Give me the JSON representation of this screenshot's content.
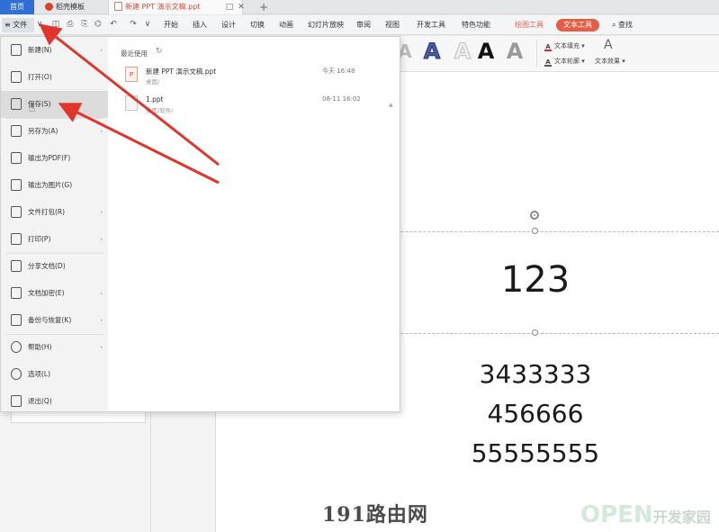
{
  "tabs": {
    "home": "首页",
    "templates": "稻壳模板",
    "document": "新建 PPT 演示文稿.ppt",
    "window_icon": "□",
    "close": "✕",
    "add": "+"
  },
  "menubar": {
    "file_label": "≡ 文件",
    "dropdown_caret": "∨",
    "items": [
      "开始",
      "插入",
      "设计",
      "切换",
      "动画",
      "幻灯片放映",
      "审阅",
      "视图",
      "开发工具",
      "特色功能"
    ],
    "drawing_tools": "绘图工具",
    "text_tools": "文本工具",
    "search": "查找",
    "quick_access": [
      "◫",
      "⎙",
      "⎘",
      "⌬",
      "↶",
      "↷",
      "∨"
    ]
  },
  "ribbon": {
    "art_samples": [
      "A",
      "A",
      "A",
      "A",
      "A"
    ],
    "text_fill": "文本填充",
    "text_outline": "文本轮廓",
    "text_effect": "文本效果",
    "effect_glyph": "A"
  },
  "file_menu": {
    "items": [
      {
        "label": "新建(N)",
        "has_submenu": true
      },
      {
        "label": "打开(O)",
        "has_submenu": false
      },
      {
        "label": "保存(S)",
        "has_submenu": false,
        "active": true
      },
      {
        "label": "另存为(A)",
        "has_submenu": true
      },
      {
        "label": "输出为PDF(F)",
        "has_submenu": false
      },
      {
        "label": "输出为图片(G)",
        "has_submenu": false
      },
      {
        "label": "文件打包(R)",
        "has_submenu": true
      },
      {
        "label": "打印(P)",
        "has_submenu": true
      },
      {
        "label": "分享文档(D)",
        "has_submenu": false
      },
      {
        "label": "文档加密(E)",
        "has_submenu": true
      },
      {
        "label": "备份与恢复(K)",
        "has_submenu": true
      },
      {
        "label": "帮助(H)",
        "has_submenu": true
      },
      {
        "label": "选项(L)",
        "has_submenu": false
      },
      {
        "label": "退出(Q)",
        "has_submenu": false
      }
    ],
    "submenu_arrow": "›",
    "recent_header": "最近使用",
    "recent_refresh": "↻",
    "recent_files": [
      {
        "name": "新建 PPT 演示文稿.ppt",
        "path": "桌面/",
        "date": "今天 16:48"
      },
      {
        "name": "1.ppt",
        "path": "桌面/软件/",
        "date": "08-11 16:02"
      }
    ],
    "file_icon_glyph": "P",
    "pin_glyph": "▲"
  },
  "slide": {
    "title_text": "123",
    "body_lines": [
      "3433333",
      "456666",
      "55555555"
    ]
  },
  "watermarks": {
    "site": "191路由网",
    "open_big": "OPEN",
    "open_small": "开发家园"
  },
  "colors": {
    "accent_blue": "#2f6fd6",
    "accent_red": "#e35d47",
    "arrow_red": "#e0352b"
  }
}
